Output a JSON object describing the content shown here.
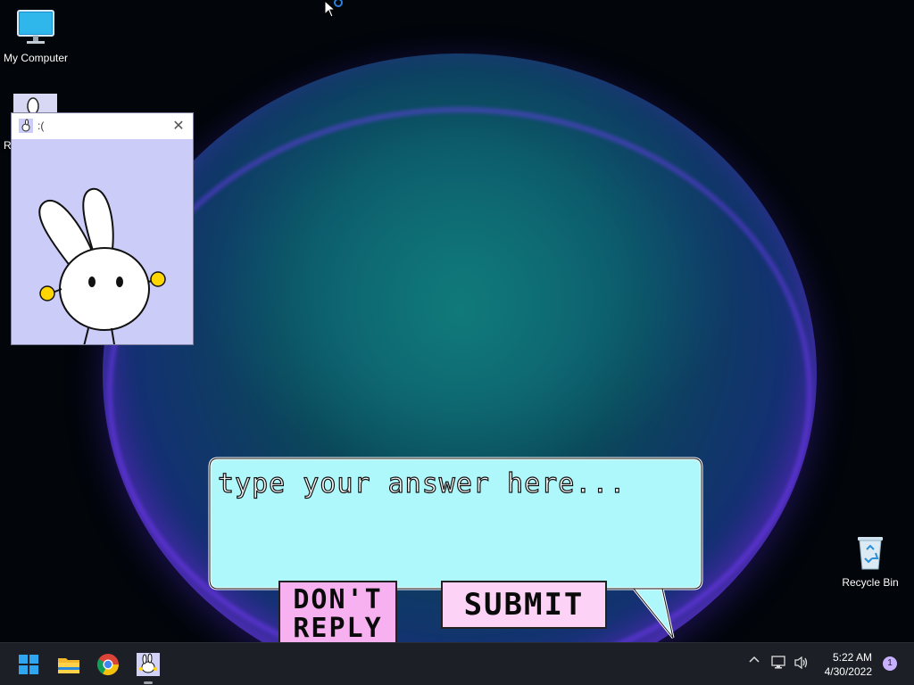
{
  "desktop": {
    "icons": [
      {
        "label": "My Computer"
      },
      {
        "label": "Recycle Bin"
      },
      {
        "label": "R"
      }
    ]
  },
  "window": {
    "title": ":(",
    "close_symbol": "✕"
  },
  "dialog": {
    "input_placeholder": "type your answer here...",
    "dont_reply_line1": "DON'T",
    "dont_reply_line2": "REPLY",
    "submit_label": "SUBMIT"
  },
  "taskbar": {
    "apps": [
      "start-icon",
      "file-explorer-icon",
      "chrome-icon",
      "bunny-app-icon"
    ],
    "time": "5:22 AM",
    "date": "4/30/2022",
    "notification_count": "1",
    "tray_chevron": "^"
  },
  "colors": {
    "bubble_fill": "#aef8fc",
    "dont_reply_bg": "#f7b1f1",
    "submit_bg": "#fcd3f6",
    "window_bg": "#ccccf8",
    "taskbar_bg": "#1c1f26"
  }
}
